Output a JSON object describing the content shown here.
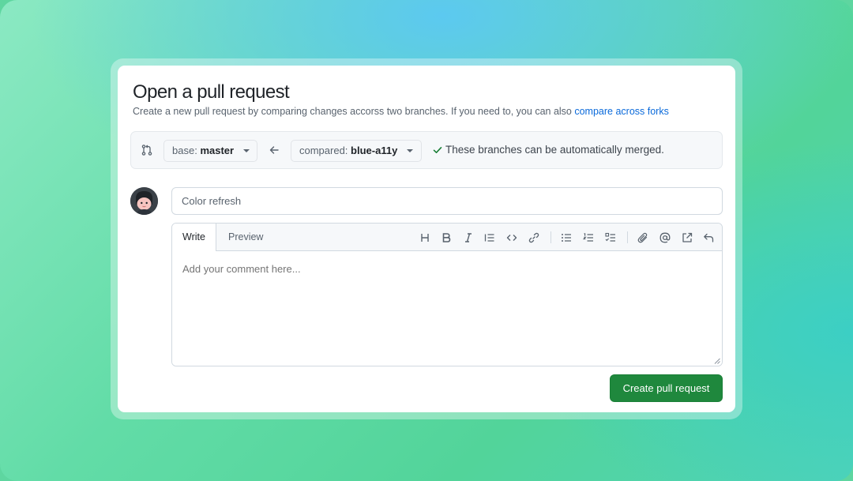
{
  "page": {
    "title": "Open a pull request",
    "subtitle": "Create a new pull request by comparing changes accorss two branches. If you need to, you can also ",
    "subtitle_link": "compare across forks"
  },
  "branches": {
    "base_prefix": "base:",
    "base_value": "master",
    "compare_prefix": "compared:",
    "compare_value": "blue-a11y",
    "merge_status": "These branches can be automatically merged."
  },
  "form": {
    "title_value": "Color refresh",
    "comment_placeholder": "Add your comment here...",
    "tabs": [
      "Write",
      "Preview"
    ],
    "submit_label": "Create pull request"
  },
  "toolbar": {
    "icons": [
      "heading-icon",
      "bold-icon",
      "italic-icon",
      "quote-icon",
      "code-icon",
      "link-icon",
      "bulleted-list-icon",
      "numbered-list-icon",
      "task-list-icon",
      "attach-icon",
      "mention-icon",
      "reference-icon",
      "undo-icon"
    ]
  },
  "colors": {
    "accent_link": "#0969da",
    "primary_button": "#1f883d",
    "success_check": "#1a7f37"
  }
}
